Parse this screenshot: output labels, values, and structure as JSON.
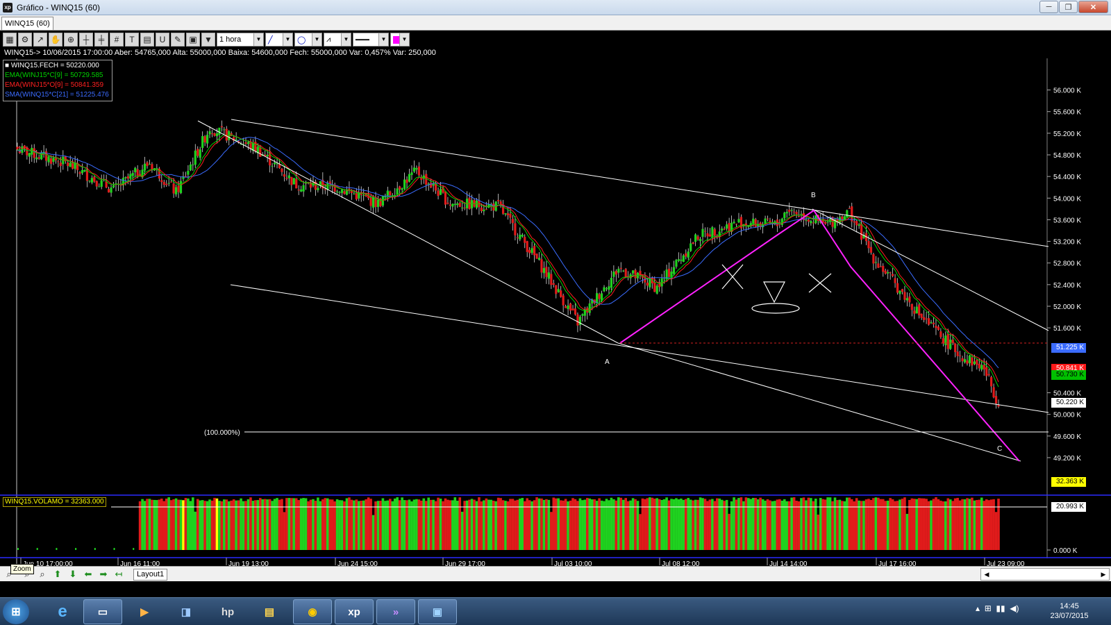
{
  "window": {
    "title": "Gráfico - WINQ15 (60)",
    "app_icon": "xp",
    "controls": {
      "minimize": "─",
      "restore": "❐",
      "close": "✕"
    }
  },
  "tab": {
    "label": "WINQ15 (60)"
  },
  "toolbar": {
    "interval": "1 hora"
  },
  "info_bar": "WINQ15-> 10/06/2015 17:00:00 Aber: 54765,000 Alta: 55000,000 Baixa: 54600,000 Fech: 55000,000 Var: 0,457% Var: 250,000",
  "legend": [
    {
      "text": "■ WINQ15.FECH = 50220.000",
      "color": "#ffffff"
    },
    {
      "text": "EMA(WINJ15*C[9] = 50729.585",
      "color": "#00d000"
    },
    {
      "text": "EMA(WINJ15*O[9] = 50841.359",
      "color": "#ff2020"
    },
    {
      "text": "SMA(WINQ15*C[21] = 51225.476",
      "color": "#3b6cff"
    }
  ],
  "y_axis": [
    "56.000 K",
    "55.600 K",
    "55.200 K",
    "54.800 K",
    "54.400 K",
    "54.000 K",
    "53.600 K",
    "53.200 K",
    "52.800 K",
    "52.400 K",
    "52.000 K",
    "51.600 K",
    "50.400 K",
    "50.000 K",
    "49.600 K",
    "49.200 K",
    "0.000 K"
  ],
  "price_labels": [
    {
      "text": "51.225 K",
      "bg": "#3b6cff",
      "fg": "#ffffff"
    },
    {
      "text": "50.841 K",
      "bg": "#ff1a1a",
      "fg": "#ffffff"
    },
    {
      "text": "50.730 K",
      "bg": "#00c000",
      "fg": "#000000"
    },
    {
      "text": "50.220 K",
      "bg": "#ffffff",
      "fg": "#000000"
    },
    {
      "text": "32.363 K",
      "bg": "#ffff00",
      "fg": "#000000"
    },
    {
      "text": "20.993 K",
      "bg": "#ffffff",
      "fg": "#000000"
    }
  ],
  "x_axis": [
    "Jun 10 17:00:00",
    "Jun 16 11:00",
    "Jun 19 13:00",
    "Jun 24 15:00",
    "Jun 29 17:00",
    "Jul 03 10:00",
    "Jul 08 12:00",
    "Jul 14 14:00",
    "Jul 17 16:00",
    "Jul 23 09:00"
  ],
  "annotations": {
    "A": "A",
    "B": "B",
    "C": "C",
    "fib": "(100.000%)"
  },
  "volume": {
    "label": "WINQ15.VOLAMO = 32363.000"
  },
  "bottom": {
    "zoom_tip": "Zoom",
    "layout_tab": "Layout1"
  },
  "taskbar": {
    "time": "14:45",
    "date": "23/07/2015",
    "apps": [
      "ie-icon",
      "folder-icon",
      "media-player-icon",
      "remote-icon",
      "hp-icon",
      "archive-icon",
      "chrome-icon",
      "xp-icon",
      "stream-icon",
      "photo-icon"
    ]
  },
  "chart_data": {
    "type": "candlestick",
    "symbol": "WINQ15",
    "interval": "1 hora",
    "ylim": [
      49200,
      56200
    ],
    "x_ticks": [
      "Jun 10 17:00:00",
      "Jun 16 11:00",
      "Jun 19 13:00",
      "Jun 24 15:00",
      "Jun 29 17:00",
      "Jul 03 10:00",
      "Jul 08 12:00",
      "Jul 14 14:00",
      "Jul 17 16:00",
      "Jul 23 09:00"
    ],
    "close_path": [
      [
        0,
        54900
      ],
      [
        20,
        54650
      ],
      [
        40,
        54150
      ],
      [
        55,
        54650
      ],
      [
        66,
        54100
      ],
      [
        80,
        55300
      ],
      [
        100,
        54900
      ],
      [
        116,
        54250
      ],
      [
        133,
        54200
      ],
      [
        150,
        53900
      ],
      [
        166,
        54500
      ],
      [
        180,
        53900
      ],
      [
        200,
        53850
      ],
      [
        217,
        52800
      ],
      [
        233,
        51700
      ],
      [
        250,
        52700
      ],
      [
        266,
        52350
      ],
      [
        283,
        53300
      ],
      [
        300,
        53550
      ],
      [
        316,
        53500
      ],
      [
        320,
        53800
      ],
      [
        336,
        53500
      ],
      [
        346,
        53750
      ],
      [
        356,
        52900
      ],
      [
        376,
        51800
      ],
      [
        392,
        51100
      ],
      [
        402,
        50850
      ],
      [
        408,
        50200
      ]
    ],
    "ema_close_9": 50729.585,
    "ema_open_9": 50841.359,
    "sma_close_21": 51225.476,
    "last_close": 50220,
    "volume_last": 32363,
    "volume_ref": 20993
  }
}
